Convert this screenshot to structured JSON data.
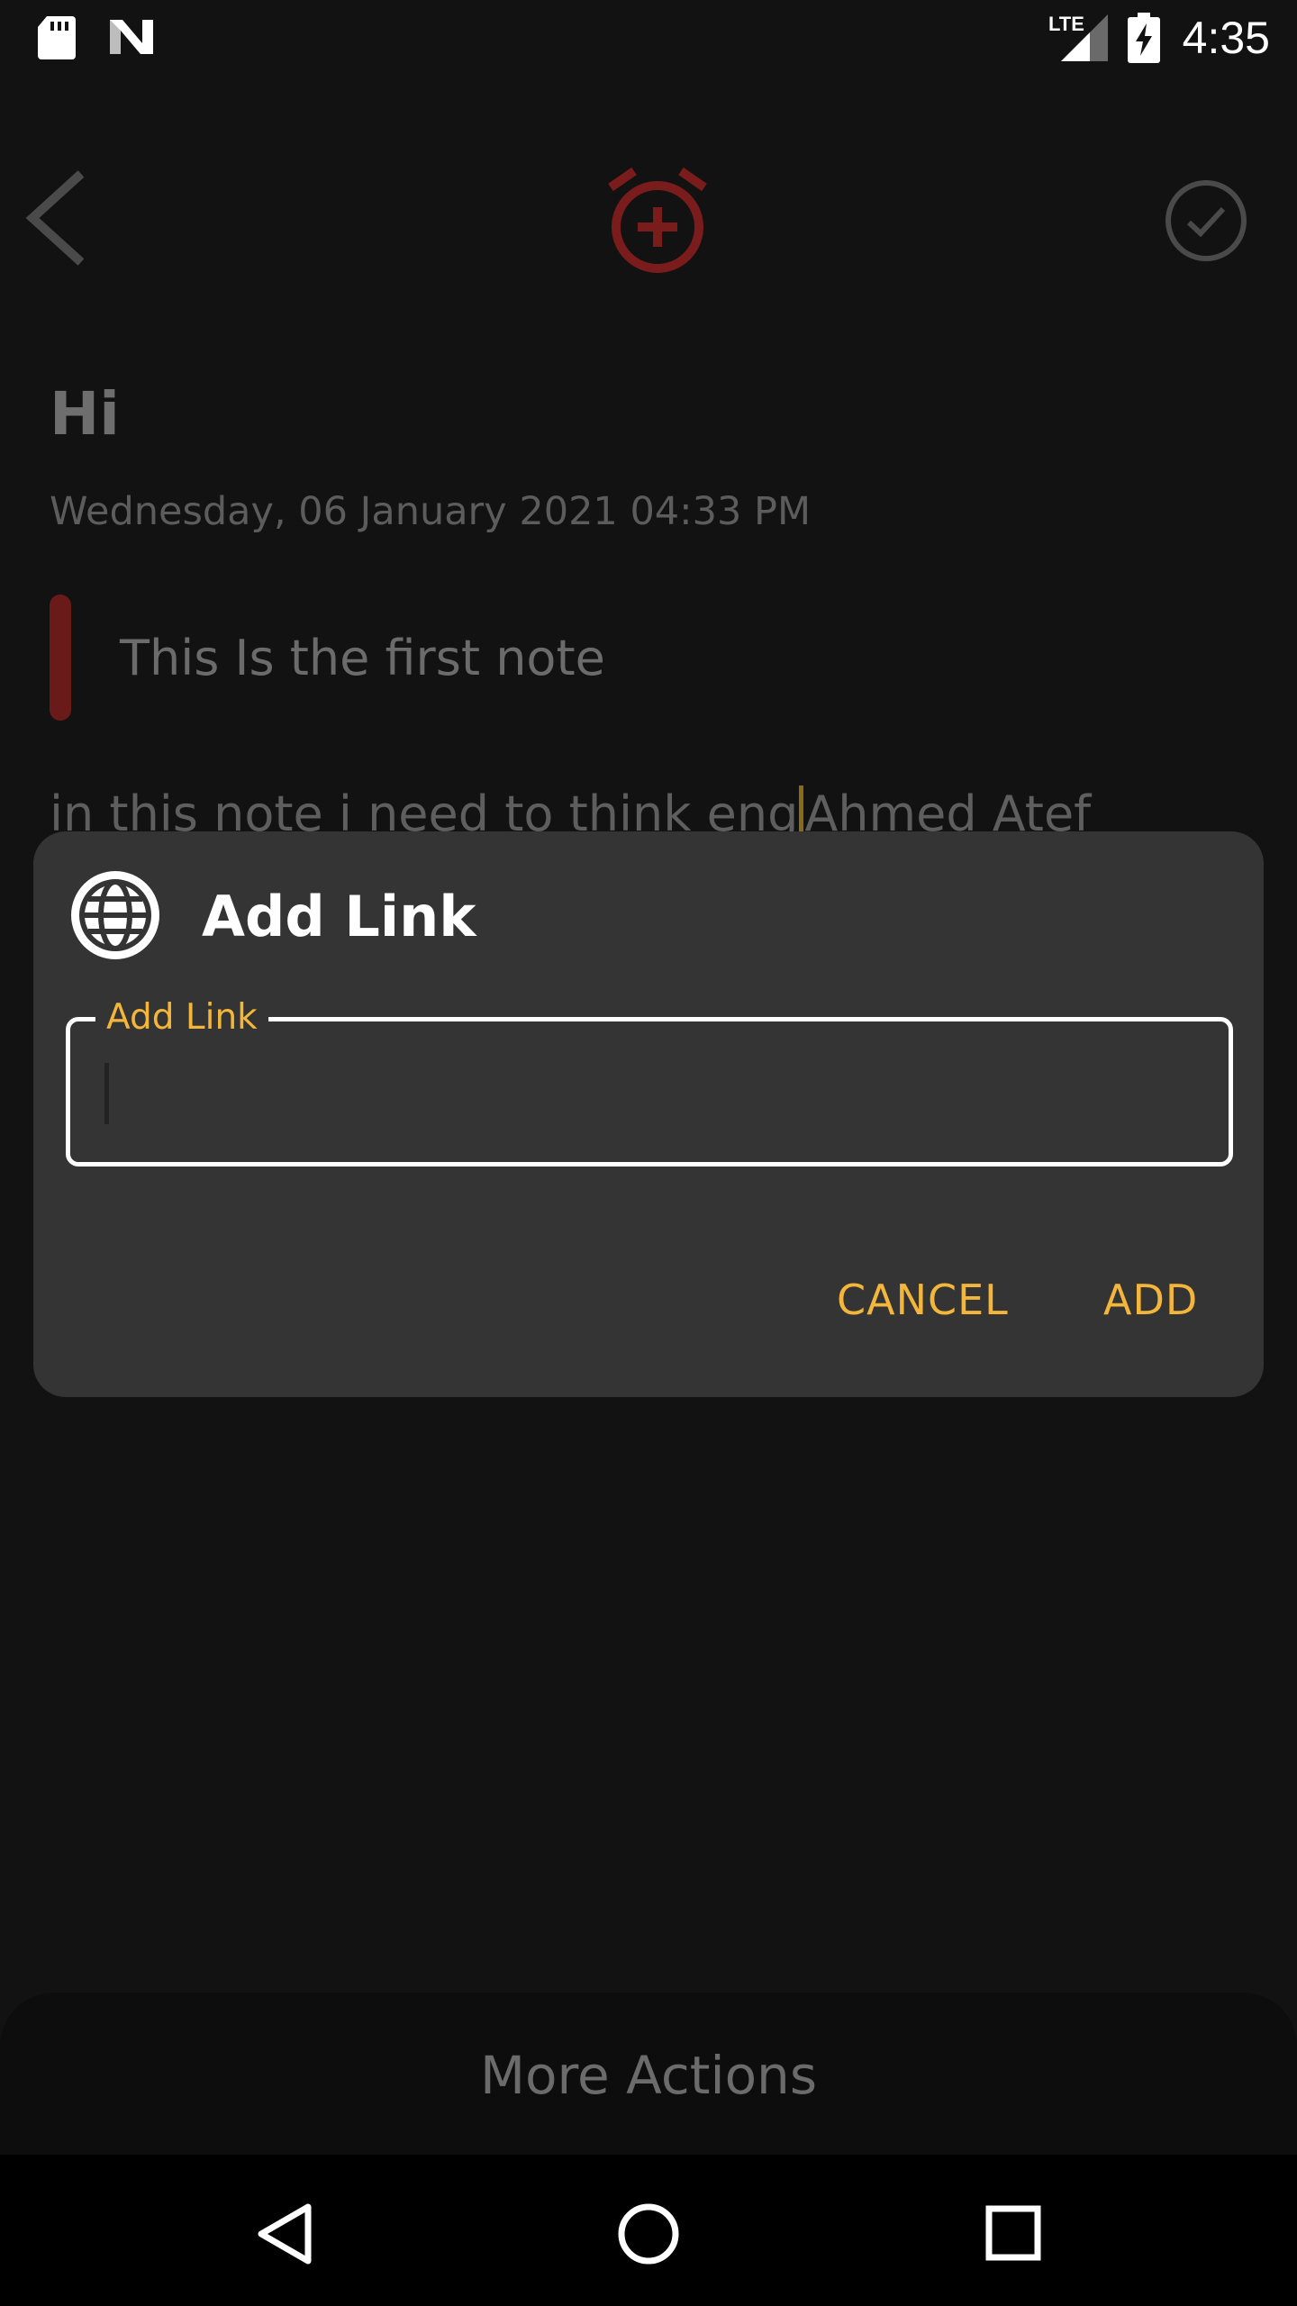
{
  "status_bar": {
    "time": "4:35",
    "network_label": "LTE",
    "icons": [
      "sd-card-icon",
      "n-logo-icon",
      "signal-icon",
      "battery-charging-icon"
    ]
  },
  "toolbar": {
    "back_icon": "chevron-left-icon",
    "alarm_icon": "alarm-add-icon",
    "done_icon": "check-circle-icon",
    "alarm_color": "#7a1c1c"
  },
  "note": {
    "title": "Hi",
    "date": "Wednesday, 06 January 2021 04:33 PM",
    "quote": "This Is the first note",
    "body_before_cursor": "in this note i need to think eng",
    "body_after_cursor": "Ahmed Atef",
    "quote_bar_color": "#6b1a1a"
  },
  "dialog": {
    "icon": "globe-icon",
    "title": "Add Link",
    "field_label": "Add Link",
    "field_value": "",
    "cancel_label": "CANCEL",
    "add_label": "ADD",
    "accent_color": "#f4b63a"
  },
  "bottom_sheet": {
    "label": "More Actions"
  },
  "nav_bar": {
    "icons": [
      "back-triangle-icon",
      "home-circle-icon",
      "recents-square-icon"
    ]
  }
}
